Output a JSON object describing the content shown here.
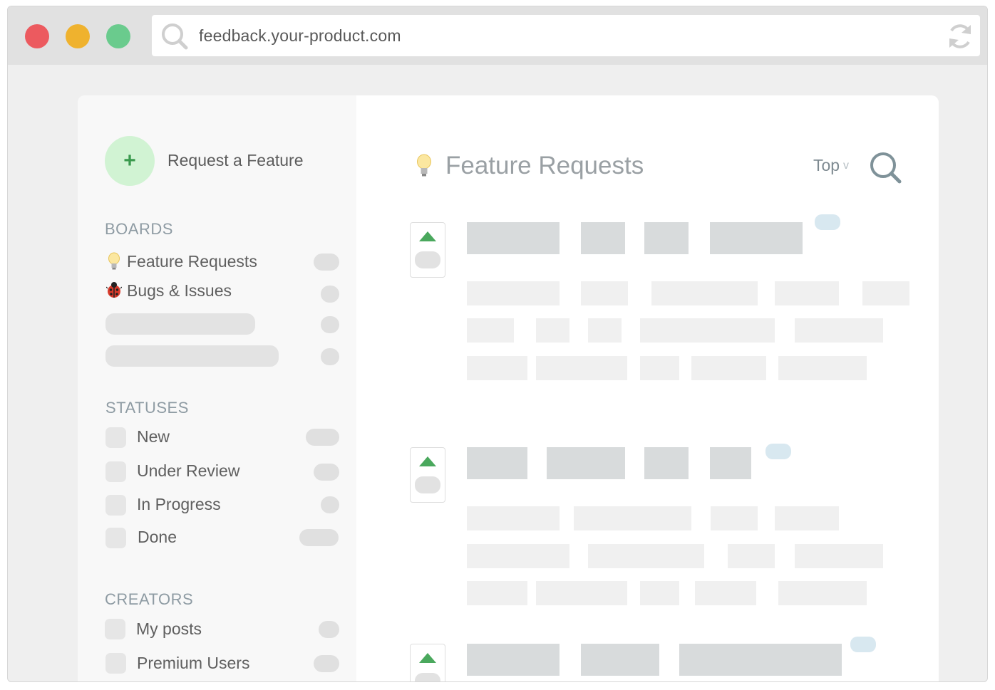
{
  "browser": {
    "url": "feedback.your-product.com",
    "icons": {
      "search": "search-icon",
      "refresh": "refresh-icon"
    }
  },
  "sidebar": {
    "request_button": {
      "icon": "+",
      "label": "Request a Feature"
    },
    "boards": {
      "title": "BOARDS",
      "items": [
        {
          "icon": "lightbulb-icon",
          "label": "Feature Requests"
        },
        {
          "icon": "ladybug-icon",
          "label": "Bugs & Issues"
        }
      ]
    },
    "statuses": {
      "title": "STATUSES",
      "items": [
        {
          "label": "New"
        },
        {
          "label": "Under Review"
        },
        {
          "label": "In Progress"
        },
        {
          "label": "Done"
        }
      ]
    },
    "creators": {
      "title": "CREATORS",
      "items": [
        {
          "label": "My posts"
        },
        {
          "label": "Premium Users"
        }
      ]
    }
  },
  "main": {
    "title": "Feature Requests",
    "title_icon": "lightbulb-icon",
    "sort": {
      "label": "Top",
      "chevron": "v"
    },
    "colors": {
      "upvote": "#4aa85d",
      "accent_green": "#d1f3d3"
    }
  }
}
